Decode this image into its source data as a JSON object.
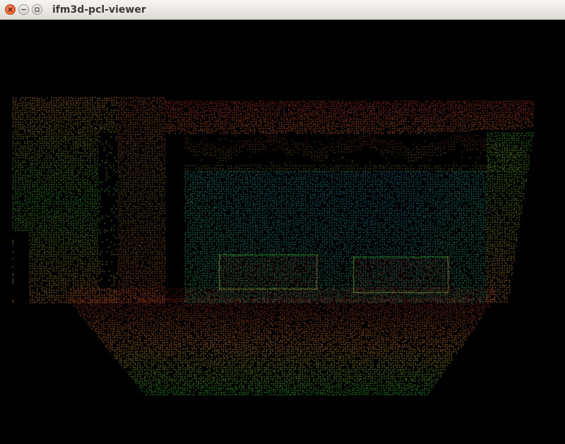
{
  "window": {
    "title": "ifm3d-pcl-viewer",
    "controls": {
      "close_icon": "close-icon",
      "minimize_icon": "minimize-icon",
      "maximize_icon": "maximize-icon"
    }
  },
  "viewer": {
    "background_color": "#000000",
    "colormap": [
      "#2a8fd0",
      "#2ec7a0",
      "#3fbf3a",
      "#b7c83a",
      "#e08a3a",
      "#c0392b"
    ]
  }
}
